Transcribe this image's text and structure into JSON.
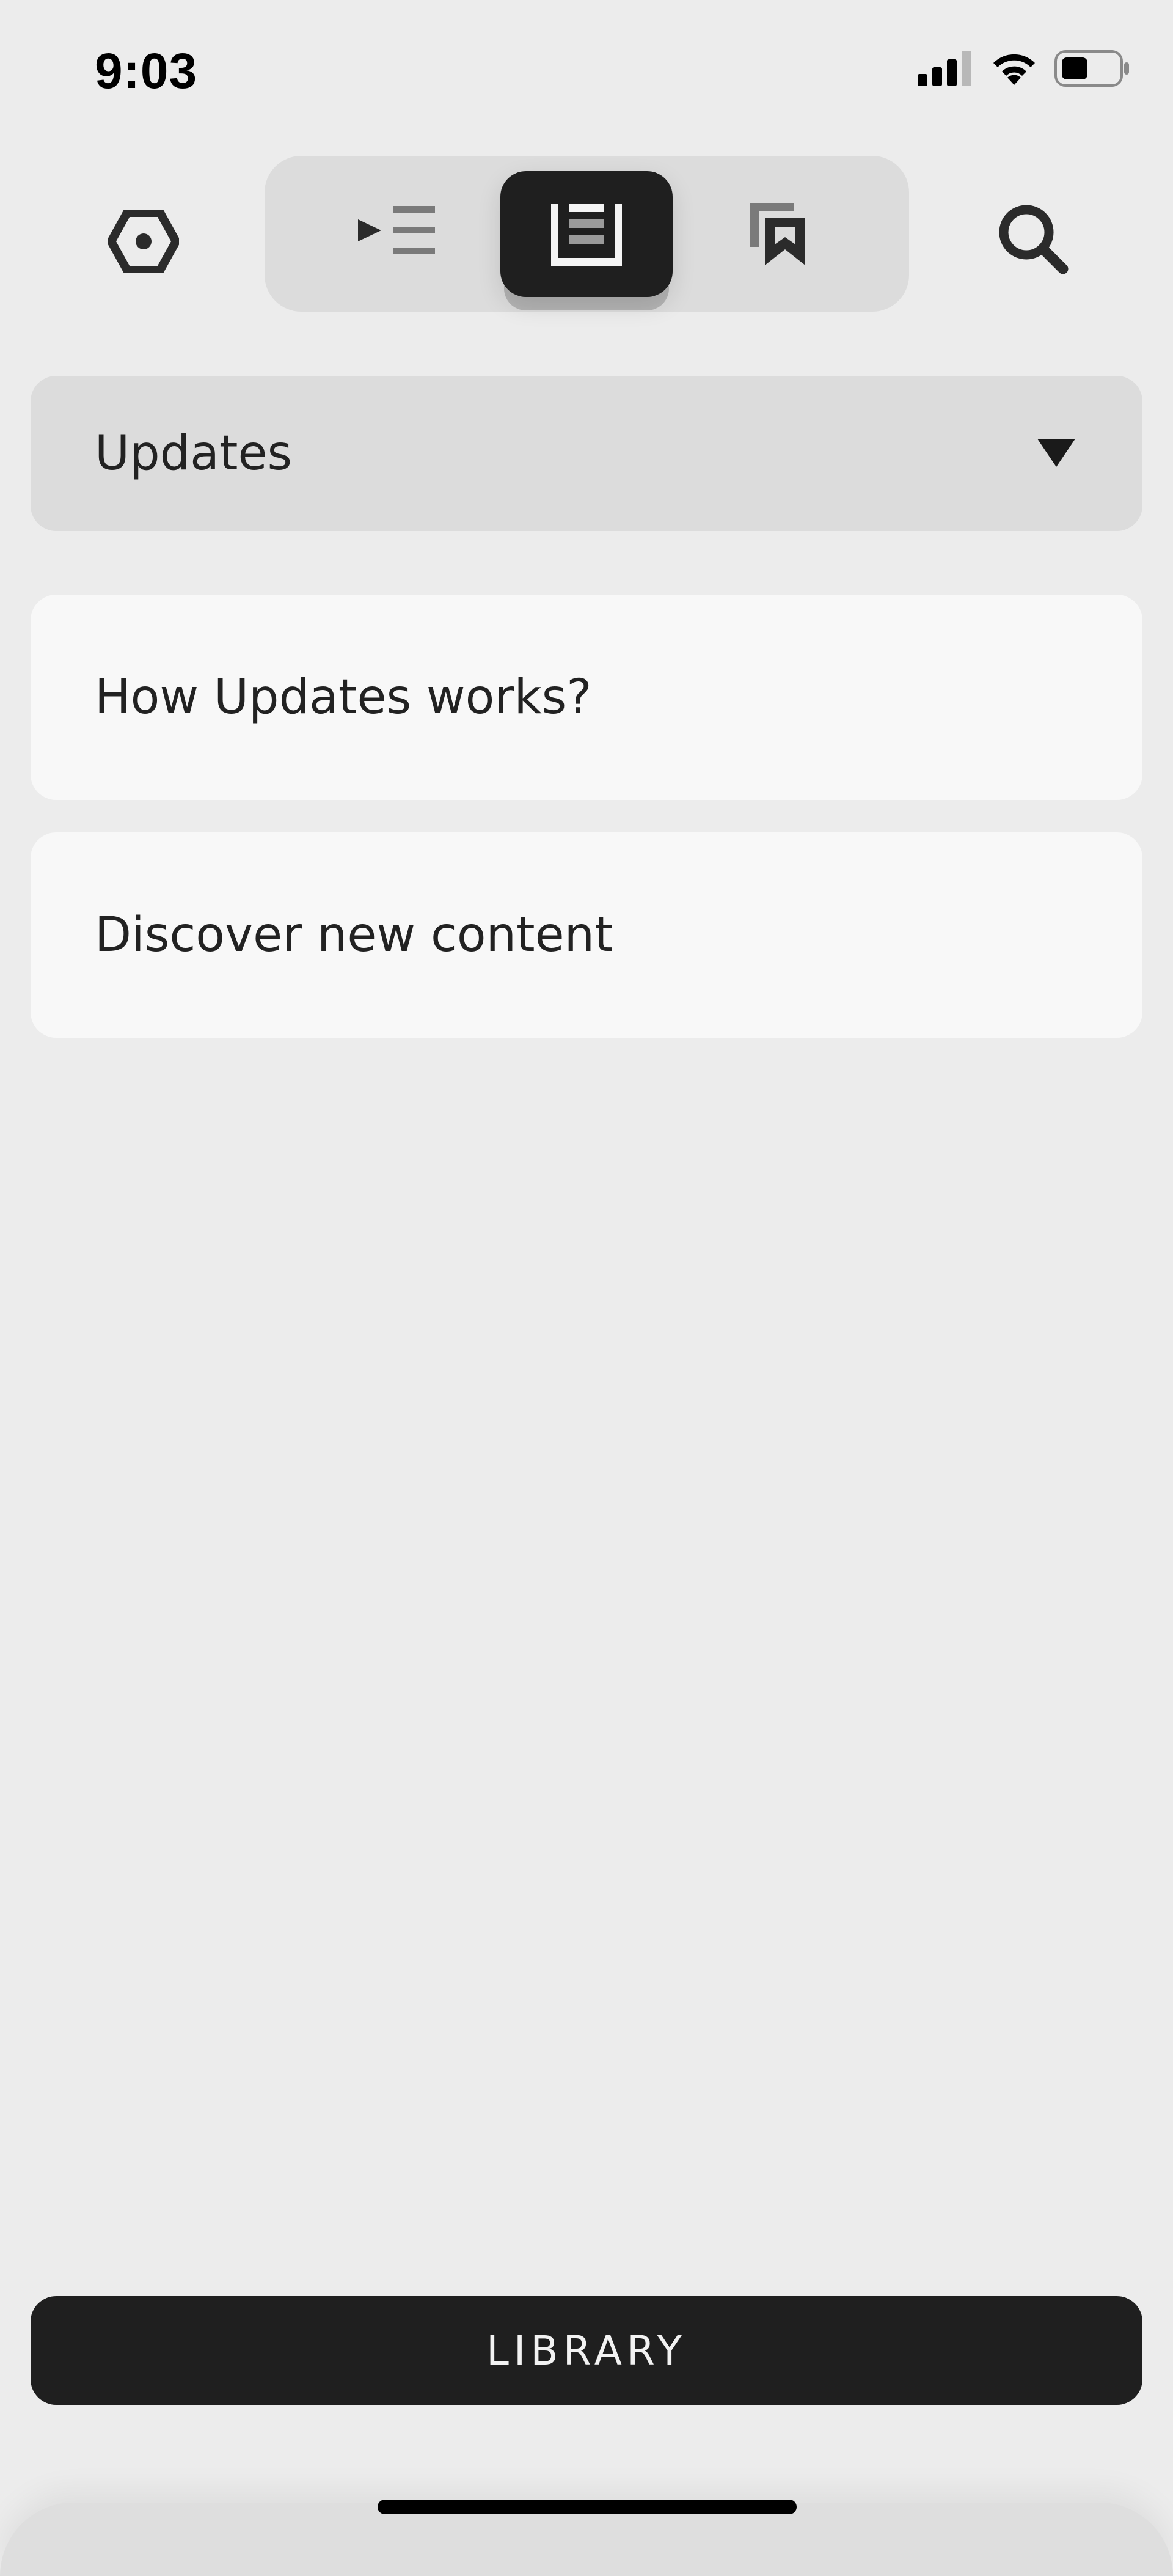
{
  "status_bar": {
    "time": "9:03",
    "icons": [
      "cellular-signal-icon",
      "wifi-icon",
      "battery-icon"
    ]
  },
  "toolbar": {
    "settings_icon": "hexagon-settings-icon",
    "tabs": [
      {
        "icon": "playlist-icon",
        "active": false
      },
      {
        "icon": "document-list-icon",
        "active": true
      },
      {
        "icon": "bookmarks-icon",
        "active": false
      }
    ],
    "search_icon": "search-icon"
  },
  "dropdown": {
    "selected": "Updates"
  },
  "list": {
    "items": [
      {
        "label": "How Updates works?"
      },
      {
        "label": "Discover new content"
      }
    ]
  },
  "footer": {
    "library_label": "LIBRARY"
  },
  "colors": {
    "background": "#ececec",
    "panel": "#dcdcdc",
    "card": "#f8f8f8",
    "dark": "#1f1f1f"
  }
}
